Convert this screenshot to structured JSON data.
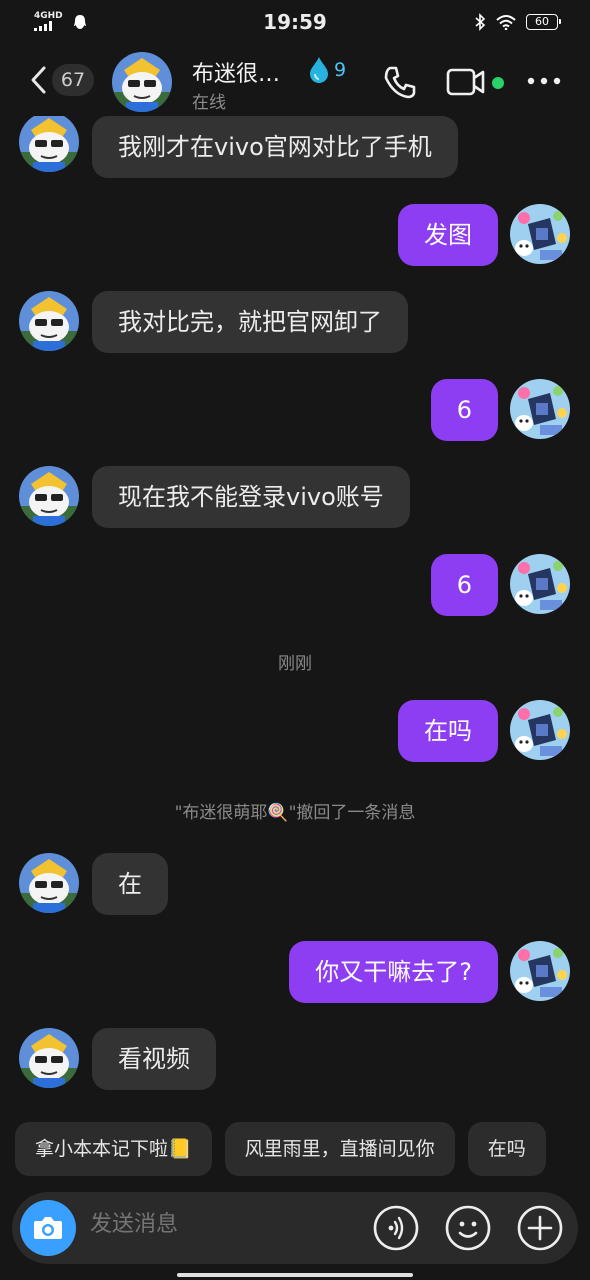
{
  "status_bar": {
    "network": "4GHD",
    "time": "19:59",
    "battery": "60"
  },
  "header": {
    "unread_count": "67",
    "contact_name": "布迷很…",
    "contact_status": "在线",
    "streak_count": "9"
  },
  "messages": [
    {
      "side": "in",
      "text": "我刚才在vivo官网对比了手机"
    },
    {
      "side": "out",
      "text": "发图"
    },
    {
      "side": "in",
      "text": "我对比完，就把官网卸了"
    },
    {
      "side": "out",
      "text": "6"
    },
    {
      "side": "in",
      "text": "现在我不能登录vivo账号"
    },
    {
      "side": "out",
      "text": "6"
    },
    {
      "side": "out",
      "text": "在吗"
    },
    {
      "side": "in",
      "text": "在"
    },
    {
      "side": "out",
      "text": "你又干嘛去了?"
    },
    {
      "side": "in",
      "text": "看视频"
    }
  ],
  "system": {
    "timestamp": "刚刚",
    "recall_notice": "\"布迷很萌耶🍭\"撤回了一条消息"
  },
  "quick_replies": [
    "拿小本本记下啦📒",
    "风里雨里，直播间见你",
    "在吗"
  ],
  "input": {
    "placeholder": "发送消息"
  },
  "colors": {
    "background": "#161616",
    "incoming_bubble": "#333333",
    "outgoing_bubble": "#8d3ef2",
    "online": "#28d269",
    "camera_button": "#3aa0ff"
  }
}
